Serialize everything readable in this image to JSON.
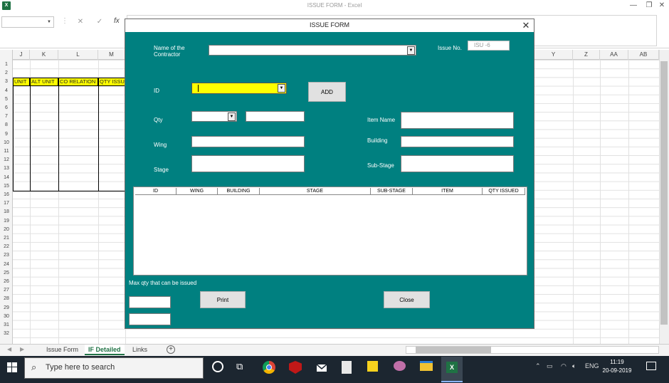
{
  "window": {
    "title": "ISSUE FORM - Excel",
    "app_icon": "excel-icon",
    "minimize": "—",
    "restore": "❐",
    "close": "✕"
  },
  "formula_bar": {
    "cancel": "✕",
    "enter": "✓",
    "fx": "fx"
  },
  "columns": [
    "J",
    "K",
    "L",
    "M",
    "Y",
    "Z",
    "AA",
    "AB"
  ],
  "rows": [
    "1",
    "2",
    "3",
    "4",
    "5",
    "6",
    "7",
    "8",
    "9",
    "10",
    "11",
    "12",
    "13",
    "14",
    "15",
    "16",
    "17",
    "18",
    "19",
    "20",
    "21",
    "22",
    "23",
    "24",
    "25",
    "26",
    "27",
    "28",
    "29",
    "30",
    "31",
    "32"
  ],
  "sheet_headers": [
    "UNIT",
    "ALT UNIT",
    "CO RELATION",
    "QTY ISSU"
  ],
  "sheet_tabs": [
    {
      "label": "Issue Form"
    },
    {
      "label": "IF Detailed",
      "active": true
    },
    {
      "label": "Links"
    }
  ],
  "add_sheet": "+",
  "dialog": {
    "title": "ISSUE FORM",
    "close": "✕",
    "contractor_label": "Name of the Contractor",
    "issue_no_label": "Issue No.",
    "issue_no_value": "ISU -6",
    "id_label": "ID",
    "add_button": "ADD",
    "qty_label": "Qty",
    "item_name_label": "Item Name",
    "wing_label": "Wing",
    "building_label": "Building",
    "stage_label": "Stage",
    "substage_label": "Sub-Stage",
    "list_columns": [
      "ID",
      "WING",
      "BUILDING",
      "STAGE",
      "SUB-STAGE",
      "ITEM",
      "QTY ISSUED"
    ],
    "max_qty_label": "Max qty that can be issued",
    "print_button": "Print",
    "close_button": "Close",
    "id_field_color": "#ffff00",
    "background_color": "#008080"
  },
  "taskbar": {
    "search_placeholder": "Type here to search",
    "time": "11:19",
    "date": "20-09-2019",
    "language": "ENG"
  }
}
